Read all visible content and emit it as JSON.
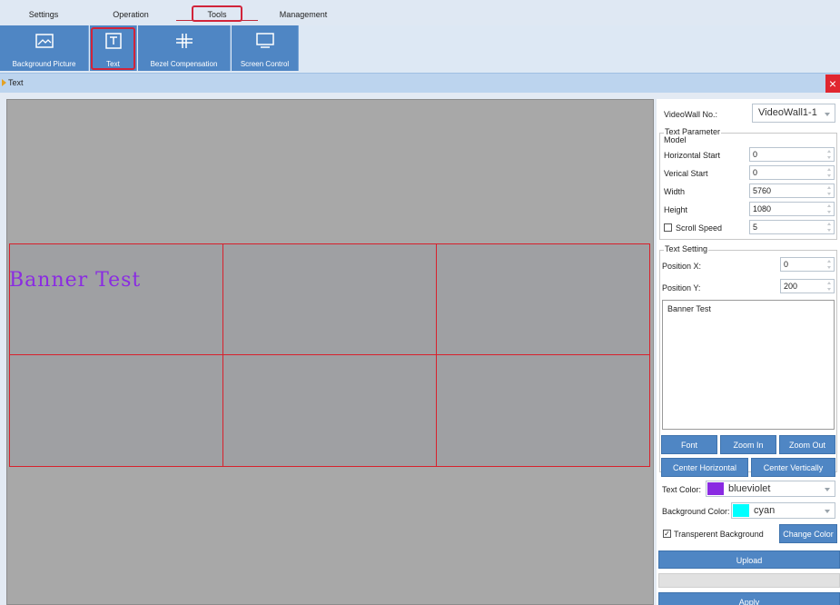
{
  "menu": {
    "items": [
      {
        "label": "Settings"
      },
      {
        "label": "Operation"
      },
      {
        "label": "Tools"
      },
      {
        "label": "Management"
      }
    ]
  },
  "toolbar": {
    "buttons": [
      {
        "label": "Background Picture",
        "icon": "picture-icon"
      },
      {
        "label": "Text",
        "icon": "text-box-icon"
      },
      {
        "label": "Bezel Compensation",
        "icon": "bezel-icon"
      },
      {
        "label": "Screen Control",
        "icon": "monitor-icon"
      }
    ]
  },
  "tab": {
    "label": "Text",
    "close": "×"
  },
  "canvas": {
    "banner_text": "Banner Test",
    "banner_color": "#8a2be2",
    "grid_rows": 2,
    "grid_cols": 3,
    "cell_border_color": "#d8212c"
  },
  "panel": {
    "videowall_label": "VideoWall No.:",
    "videowall_value": "VideoWall1-1",
    "text_param_group": "Text Parameter",
    "model_label": "Model",
    "horizontal_start_label": "Horizontal Start",
    "horizontal_start_value": "0",
    "vertical_start_label": "Verical Start",
    "vertical_start_value": "0",
    "width_label": "Width",
    "width_value": "5760",
    "height_label": "Height",
    "height_value": "1080",
    "scroll_speed_label": "Scroll Speed",
    "scroll_speed_checked": false,
    "scroll_speed_value": "5",
    "text_setting_group": "Text Setting",
    "position_x_label": "Position X:",
    "position_x_value": "0",
    "position_y_label": "Position Y:",
    "position_y_value": "200",
    "text_content": "Banner Test",
    "font_button": "Font",
    "zoom_in_button": "Zoom In",
    "zoom_out_button": "Zoom Out",
    "center_horizontal_button": "Center Horizontal",
    "center_vertically_button": "Center Vertically",
    "text_color_label": "Text Color:",
    "text_color_value": "blueviolet",
    "text_color_hex": "#8a2be2",
    "background_color_label": "Background Color:",
    "background_color_value": "cyan",
    "background_color_hex": "#00ffff",
    "transparent_label": "Transperent Background",
    "transparent_checked": true,
    "change_color_button": "Change Color",
    "upload_button": "Upload",
    "apply_button": "Apply"
  },
  "colors": {
    "accent_blue": "#4f86c4",
    "highlight_red": "#d1243a"
  }
}
